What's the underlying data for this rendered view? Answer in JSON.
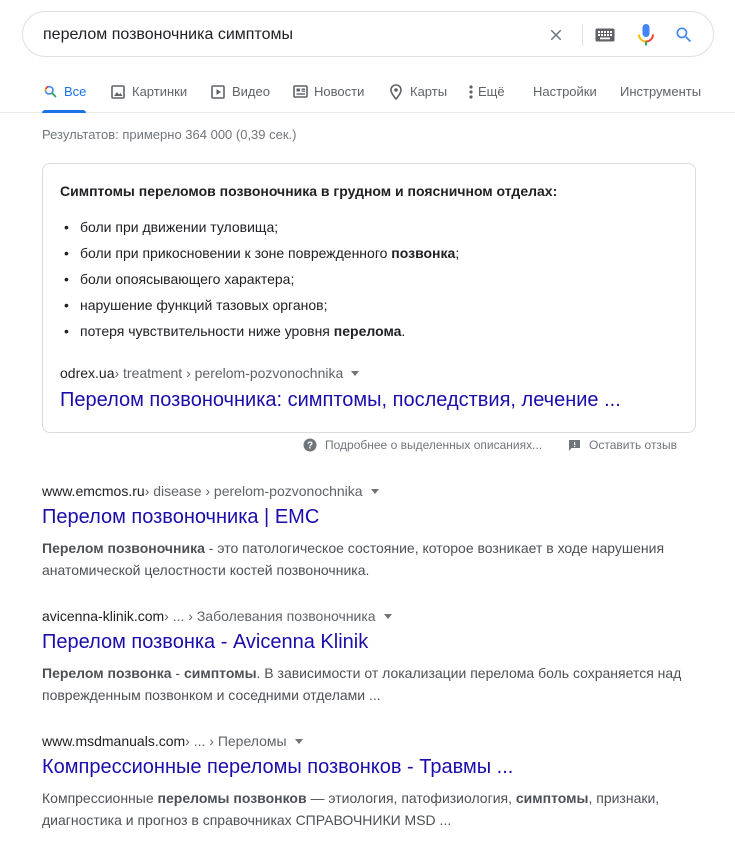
{
  "search": {
    "query": "перелом позвоночника симптомы"
  },
  "icons": {
    "clear": "close-icon",
    "keyboard": "keyboard-icon",
    "mic": "microphone-icon",
    "search": "search-icon"
  },
  "colors": {
    "accent": "#1a73e8",
    "link": "#1a0dab",
    "mic_blue": "#4285f4",
    "mic_red": "#ea4335",
    "mic_yellow": "#fbbc04",
    "mic_green": "#34a853"
  },
  "tabs": [
    {
      "label": "Все",
      "icon": "search-icon",
      "active": true
    },
    {
      "label": "Картинки",
      "icon": "image-icon"
    },
    {
      "label": "Видео",
      "icon": "video-icon"
    },
    {
      "label": "Новости",
      "icon": "news-icon"
    },
    {
      "label": "Карты",
      "icon": "map-pin-icon"
    },
    {
      "label": "Ещё",
      "icon": "more-vertical-icon"
    },
    {
      "label": "Настройки"
    },
    {
      "label": "Инструменты"
    }
  ],
  "result_stats": "Результатов: примерно 364 000 (0,39 сек.) ",
  "featured": {
    "heading": "Симптомы переломов позвоночника в грудном и поясничном отделах:",
    "items": [
      {
        "pre": "боли при движении туловища;",
        "bold": "",
        "post": ""
      },
      {
        "pre": "боли при прикосновении к зоне поврежденного ",
        "bold": "позвонка",
        "post": ";"
      },
      {
        "pre": "боли опоясывающего характера;",
        "bold": "",
        "post": ""
      },
      {
        "pre": "нарушение функций тазовых органов;",
        "bold": "",
        "post": ""
      },
      {
        "pre": "потеря чувствительности ниже уровня ",
        "bold": "перелома",
        "post": "."
      }
    ],
    "cite_domain": "odrex.ua",
    "cite_path": " › treatment › perelom-pozvonochnika",
    "title": "Перелом позвоночника: симптомы, последствия, лечение ..."
  },
  "feedback": {
    "about": "Подробнее о выделенных описаниях...",
    "leave": "Оставить отзыв"
  },
  "results": [
    {
      "domain": "www.emcmos.ru",
      "path": " › disease › perelom-pozvonochnika",
      "title": "Перелом позвоночника | ЕМС",
      "snippet": {
        "b1": "Перелом позвоночника",
        "t1": " - это патологическое состояние, которое возникает в ходе нарушения анатомической целостности костей позвоночника.",
        "b2": "",
        "t2": ""
      }
    },
    {
      "domain": "avicenna-klinik.com",
      "path": " › ... › Заболевания позвоночника",
      "title": "Перелом позвонка - Avicenna Klinik",
      "snippet": {
        "b1": "Перелом позвонка",
        "t1": " - ",
        "b2": "симптомы",
        "t2": ". В зависимости от локализации перелома боль сохраняется над поврежденным позвонком и соседними отделами ..."
      }
    },
    {
      "domain": "www.msdmanuals.com",
      "path": " › ... › Переломы",
      "title": "Компрессионные переломы позвонков - Травмы ...",
      "snippet": {
        "t0": "Компрессионные ",
        "b1": "переломы позвонков",
        "t1": " — этиология, патофизиология, ",
        "b2": "симптомы",
        "t2": ", признаки, диагностика и прогноз в справочниках СПРАВОЧНИКИ MSD ..."
      }
    }
  ]
}
